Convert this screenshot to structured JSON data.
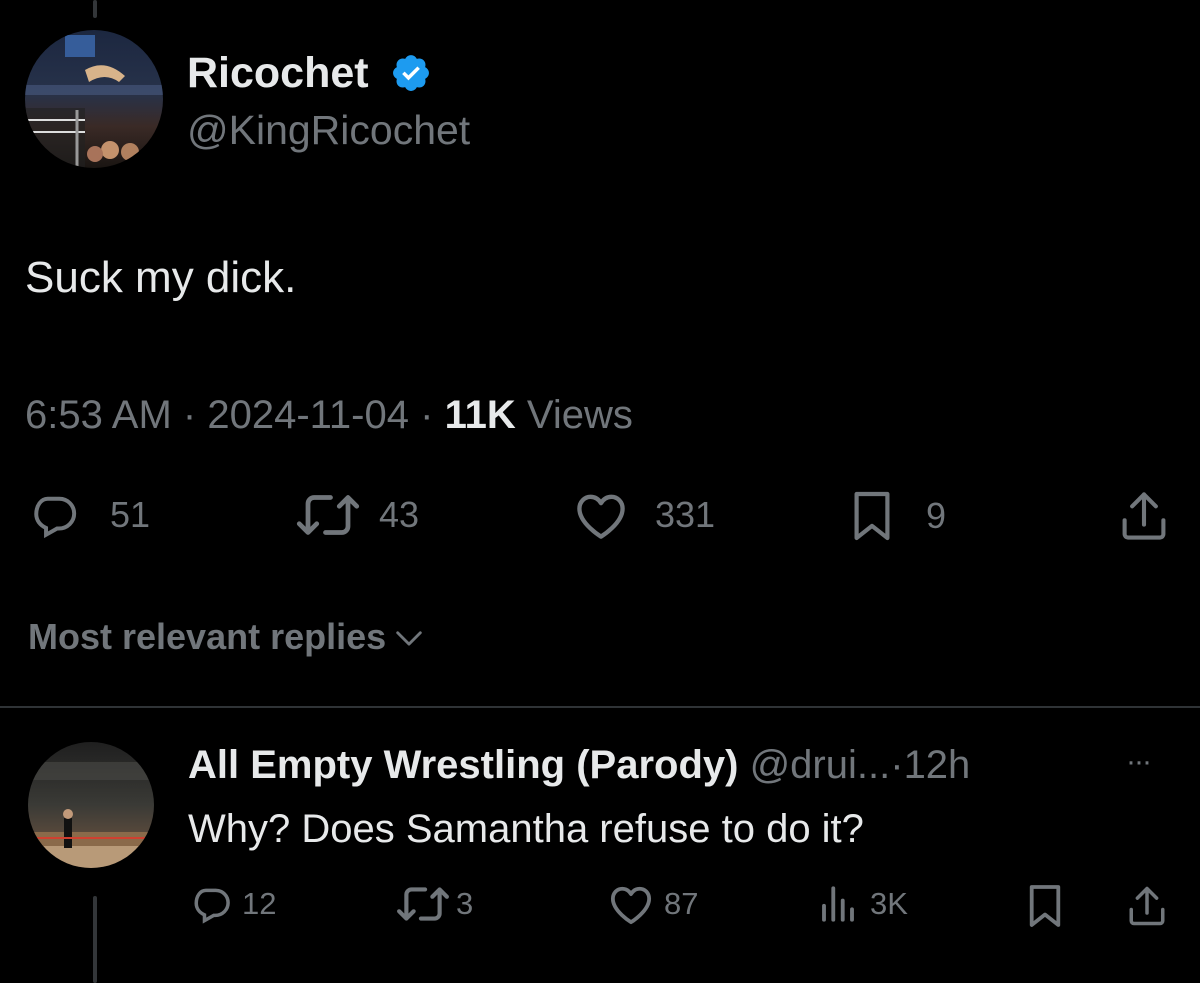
{
  "main_tweet": {
    "author_name": "Ricochet",
    "author_handle": "@KingRicochet",
    "verified": true,
    "text": "Suck my dick.",
    "time": "6:53 AM",
    "date": "2024-11-04",
    "views_count": "11K",
    "views_label": "Views",
    "separator": "·",
    "actions": {
      "replies": "51",
      "reposts": "43",
      "likes": "331",
      "bookmarks": "9"
    }
  },
  "replies_sort": {
    "label": "Most relevant replies"
  },
  "reply": {
    "author_name": "All Empty Wrestling (Parody)",
    "author_handle": "@drui...",
    "separator": "·",
    "age": "12h",
    "more": "···",
    "text": "Why? Does Samantha refuse to do it?",
    "actions": {
      "replies": "12",
      "reposts": "3",
      "likes": "87",
      "views": "3K"
    }
  },
  "colors": {
    "background": "#000000",
    "text": "#e7e9ea",
    "muted": "#71767b",
    "verified": "#1d9bf0",
    "divider": "#2f3336"
  },
  "icons": [
    "verified-badge-icon",
    "reply-icon",
    "repost-icon",
    "like-icon",
    "bookmark-icon",
    "share-icon",
    "chevron-down-icon",
    "more-icon",
    "views-icon"
  ]
}
